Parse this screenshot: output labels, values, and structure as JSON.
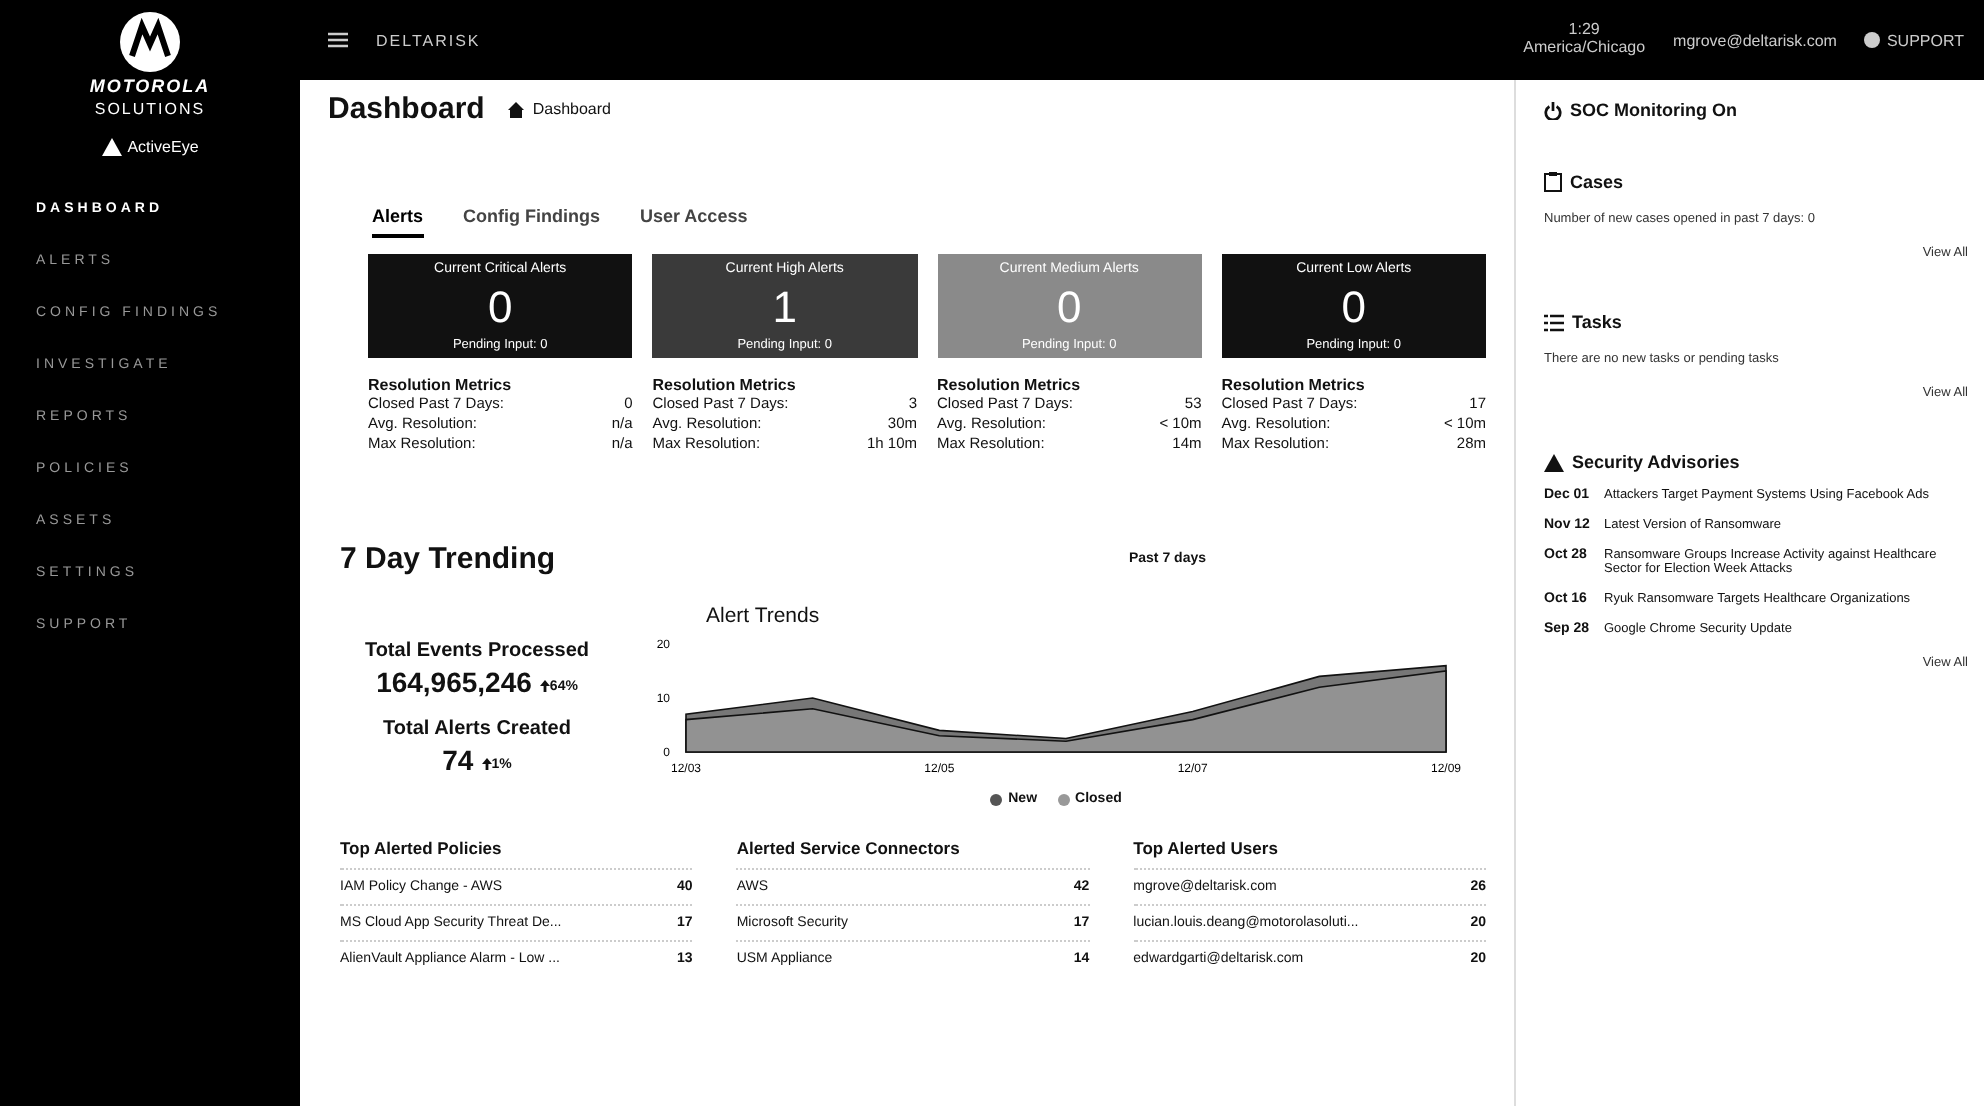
{
  "sidebar": {
    "brand": "MOTOROLA",
    "brand_sub": "SOLUTIONS",
    "product": "ActiveEye",
    "items": [
      {
        "label": "DASHBOARD",
        "selected": true
      },
      {
        "label": "ALERTS",
        "selected": false
      },
      {
        "label": "CONFIG FINDINGS",
        "selected": false
      },
      {
        "label": "INVESTIGATE",
        "selected": false
      },
      {
        "label": "REPORTS",
        "selected": false
      },
      {
        "label": "POLICIES",
        "selected": false
      },
      {
        "label": "ASSETS",
        "selected": false
      },
      {
        "label": "SETTINGS",
        "selected": false
      },
      {
        "label": "SUPPORT",
        "selected": false
      }
    ]
  },
  "top_bar": {
    "org": "DELTARISK",
    "time": "1:29",
    "timezone": "America/Chicago",
    "user": "mgrove@deltarisk.com",
    "support": "SUPPORT"
  },
  "header": {
    "title": "Dashboard",
    "breadcrumb": "Dashboard"
  },
  "tabs": [
    {
      "label": "Alerts",
      "selected": true
    },
    {
      "label": "Config Findings",
      "selected": false
    },
    {
      "label": "User Access",
      "selected": false
    }
  ],
  "alert_cards": [
    {
      "title": "Current Critical Alerts",
      "count": "0",
      "pending": "Pending Input: 0",
      "color": "#111111",
      "metrics_title": "Resolution Metrics",
      "metrics": [
        [
          "Closed Past 7 Days:",
          "0"
        ],
        [
          "Avg. Resolution:",
          "n/a"
        ],
        [
          "Max Resolution:",
          "n/a"
        ]
      ]
    },
    {
      "title": "Current High Alerts",
      "count": "1",
      "pending": "Pending Input: 0",
      "color": "#3a3a3a",
      "metrics_title": "Resolution Metrics",
      "metrics": [
        [
          "Closed Past 7 Days:",
          "3"
        ],
        [
          "Avg. Resolution:",
          "30m"
        ],
        [
          "Max Resolution:",
          "1h 10m"
        ]
      ]
    },
    {
      "title": "Current Medium Alerts",
      "count": "0",
      "pending": "Pending Input: 0",
      "color": "#8a8a8a",
      "metrics_title": "Resolution Metrics",
      "metrics": [
        [
          "Closed Past 7 Days:",
          "53"
        ],
        [
          "Avg. Resolution:",
          "< 10m"
        ],
        [
          "Max Resolution:",
          "14m"
        ]
      ]
    },
    {
      "title": "Current Low Alerts",
      "count": "0",
      "pending": "Pending Input: 0",
      "color": "#111111",
      "metrics_title": "Resolution Metrics",
      "metrics": [
        [
          "Closed Past 7 Days:",
          "17"
        ],
        [
          "Avg. Resolution:",
          "< 10m"
        ],
        [
          "Max Resolution:",
          "28m"
        ]
      ]
    }
  ],
  "trending": {
    "title": "7 Day Trending",
    "range": "Past 7 days",
    "stats": [
      {
        "label": "Total Events Processed",
        "value": "164,965,246",
        "change": "64%"
      },
      {
        "label": "Total Alerts Created",
        "value": "74",
        "change": "1%"
      }
    ],
    "chart_data": {
      "type": "area",
      "title": "Alert Trends",
      "categories": [
        "12/03",
        null,
        "12/05",
        null,
        "12/07",
        null,
        "12/09"
      ],
      "yticks": [
        0,
        10,
        20
      ],
      "ylim": [
        0,
        20
      ],
      "series": [
        {
          "name": "New",
          "color": "#555555",
          "values": [
            7,
            10,
            4,
            2.5,
            7.5,
            14,
            16
          ]
        },
        {
          "name": "Closed",
          "color": "#999999",
          "values": [
            6,
            8,
            3,
            2,
            6,
            12,
            15
          ]
        }
      ]
    }
  },
  "tables": [
    {
      "title": "Top Alerted Policies",
      "rows": [
        [
          "IAM Policy Change - AWS",
          "40"
        ],
        [
          "MS Cloud App Security Threat De...",
          "17"
        ],
        [
          "AlienVault Appliance Alarm - Low ...",
          "13"
        ]
      ]
    },
    {
      "title": "Alerted Service Connectors",
      "rows": [
        [
          "AWS",
          "42"
        ],
        [
          "Microsoft Security",
          "17"
        ],
        [
          "USM Appliance",
          "14"
        ]
      ]
    },
    {
      "title": "Top Alerted Users",
      "rows": [
        [
          "mgrove@deltarisk.com",
          "26"
        ],
        [
          "lucian.louis.deang@motorolasoluti...",
          "20"
        ],
        [
          "edwardgarti@deltarisk.com",
          "20"
        ]
      ]
    }
  ],
  "right_panel": {
    "monitoring": "SOC Monitoring On",
    "cases": {
      "title": "Cases",
      "text": "Number of new cases opened in past 7 days: 0",
      "link": "View All"
    },
    "tasks": {
      "title": "Tasks",
      "text": "There are no new tasks or pending tasks",
      "link": "View All"
    },
    "advisories": {
      "title": "Security Advisories",
      "items": [
        {
          "date": "Dec 01",
          "text": "Attackers Target Payment Systems Using Facebook Ads"
        },
        {
          "date": "Nov 12",
          "text": "Latest Version of Ransomware"
        },
        {
          "date": "Oct 28",
          "text": "Ransomware Groups Increase Activity against Healthcare Sector for Election Week Attacks"
        },
        {
          "date": "Oct 16",
          "text": "Ryuk Ransomware Targets Healthcare Organizations"
        },
        {
          "date": "Sep 28",
          "text": "Google Chrome Security Update"
        }
      ],
      "link": "View All"
    }
  }
}
